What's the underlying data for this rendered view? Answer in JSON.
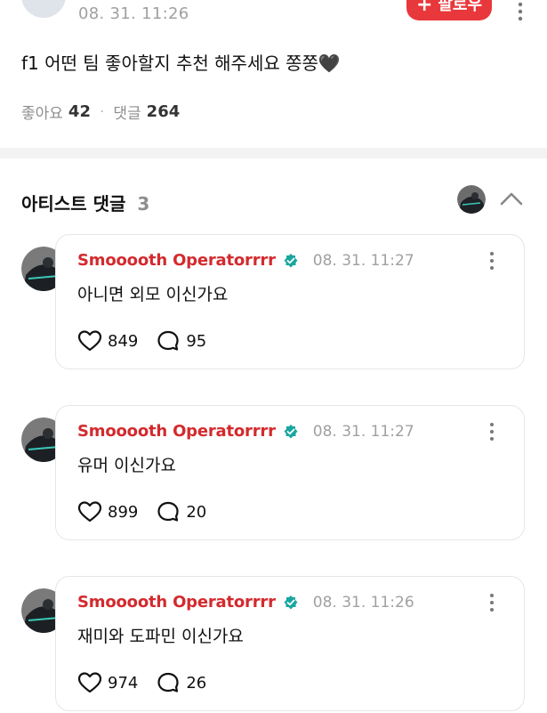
{
  "post": {
    "time": "08. 31. 11:26",
    "follow_label": "팔로우",
    "text": "f1 어떤 팀 좋아할지 추천 해주세요 쫑쫑🖤",
    "likes_label": "좋아요",
    "likes_count": "42",
    "comments_label": "댓글",
    "comments_count": "264"
  },
  "section": {
    "title": "아티스트 댓글",
    "count": "3"
  },
  "comments": [
    {
      "author": "Smooooth Operatorrrr",
      "time": "08. 31. 11:27",
      "text": "아니면 외모 이신가요",
      "likes": "849",
      "replies": "95"
    },
    {
      "author": "Smooooth Operatorrrr",
      "time": "08. 31. 11:27",
      "text": "유머 이신가요",
      "likes": "899",
      "replies": "20"
    },
    {
      "author": "Smooooth Operatorrrr",
      "time": "08. 31. 11:26",
      "text": "재미와 도파민 이신가요",
      "likes": "974",
      "replies": "26"
    }
  ],
  "colors": {
    "accent_red": "#e8383b",
    "author_red": "#d32a2e",
    "verified_teal": "#1aa6a0",
    "muted_gray": "#a0a0a0"
  },
  "icons": {
    "more": "more-vertical-icon",
    "verified": "verified-badge-icon",
    "like": "heart-icon",
    "reply": "speech-bubble-icon",
    "collapse": "chevron-up-icon"
  }
}
